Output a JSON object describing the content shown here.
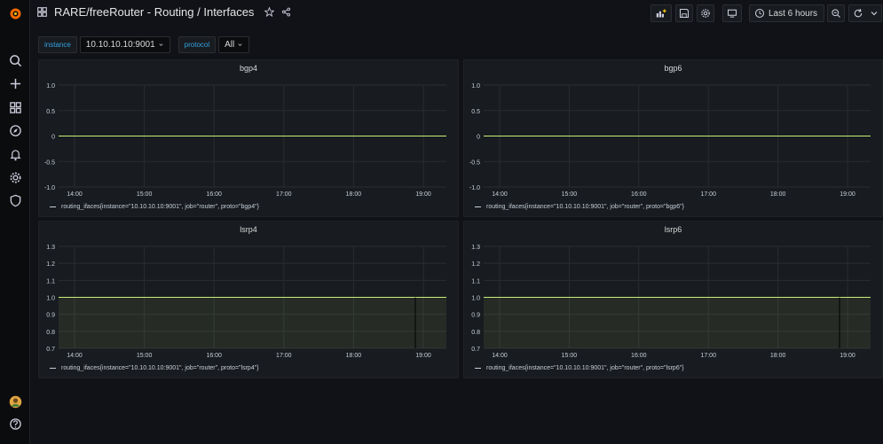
{
  "dashboard": {
    "title": "RARE/freeRouter - Routing / Interfaces"
  },
  "toolbar": {
    "time_range": "Last 6 hours"
  },
  "variables": [
    {
      "label": "instance",
      "value": "10.10.10.10:9001"
    },
    {
      "label": "protocol",
      "value": "All"
    }
  ],
  "colors": {
    "series": "#c8f07c",
    "grid": "#2a2c31",
    "accent": "#33a2e5"
  },
  "icons": {
    "sidebar": [
      "grafana-logo-icon",
      "search-icon",
      "plus-icon",
      "dashboards-icon",
      "explore-icon",
      "alerting-icon",
      "gear-icon",
      "shield-icon",
      "avatar",
      "help-icon"
    ],
    "toolbar": [
      "add-panel-icon",
      "save-icon",
      "gear-icon",
      "tv-icon",
      "clock-icon",
      "zoom-out-icon",
      "refresh-icon"
    ]
  },
  "chart_data": [
    {
      "type": "line",
      "title": "bgp4",
      "x": [
        "14:00",
        "15:00",
        "16:00",
        "17:00",
        "18:00",
        "19:00"
      ],
      "yticks": [
        "1.0",
        "0.5",
        "0",
        "-0.5",
        "-1.0"
      ],
      "ylim": [
        -1.0,
        1.0
      ],
      "series": [
        {
          "name": "routing_ifaces{instance=\"10.10.10.10:9001\", job=\"router\", proto=\"bgp4\"}",
          "values": [
            0,
            0,
            0,
            0,
            0,
            0
          ]
        }
      ],
      "fill": false
    },
    {
      "type": "line",
      "title": "bgp6",
      "x": [
        "14:00",
        "15:00",
        "16:00",
        "17:00",
        "18:00",
        "19:00"
      ],
      "yticks": [
        "1.0",
        "0.5",
        "0",
        "-0.5",
        "-1.0"
      ],
      "ylim": [
        -1.0,
        1.0
      ],
      "series": [
        {
          "name": "routing_ifaces{instance=\"10.10.10.10:9001\", job=\"router\", proto=\"bgp6\"}",
          "values": [
            0,
            0,
            0,
            0,
            0,
            0
          ]
        }
      ],
      "fill": false
    },
    {
      "type": "area",
      "title": "lsrp4",
      "x": [
        "14:00",
        "15:00",
        "16:00",
        "17:00",
        "18:00",
        "19:00"
      ],
      "yticks": [
        "1.3",
        "1.2",
        "1.1",
        "1.0",
        "0.9",
        "0.8",
        "0.7"
      ],
      "ylim": [
        0.7,
        1.3
      ],
      "series": [
        {
          "name": "routing_ifaces{instance=\"10.10.10.10:9001\", job=\"router\", proto=\"lsrp4\"}",
          "values": [
            1,
            1,
            1,
            1,
            1,
            1
          ]
        }
      ],
      "fill": true
    },
    {
      "type": "area",
      "title": "lsrp6",
      "x": [
        "14:00",
        "15:00",
        "16:00",
        "17:00",
        "18:00",
        "19:00"
      ],
      "yticks": [
        "1.3",
        "1.2",
        "1.1",
        "1.0",
        "0.9",
        "0.8",
        "0.7"
      ],
      "ylim": [
        0.7,
        1.3
      ],
      "series": [
        {
          "name": "routing_ifaces{instance=\"10.10.10.10:9001\", job=\"router\", proto=\"lsrp6\"}",
          "values": [
            1,
            1,
            1,
            1,
            1,
            1
          ]
        }
      ],
      "fill": true
    }
  ]
}
